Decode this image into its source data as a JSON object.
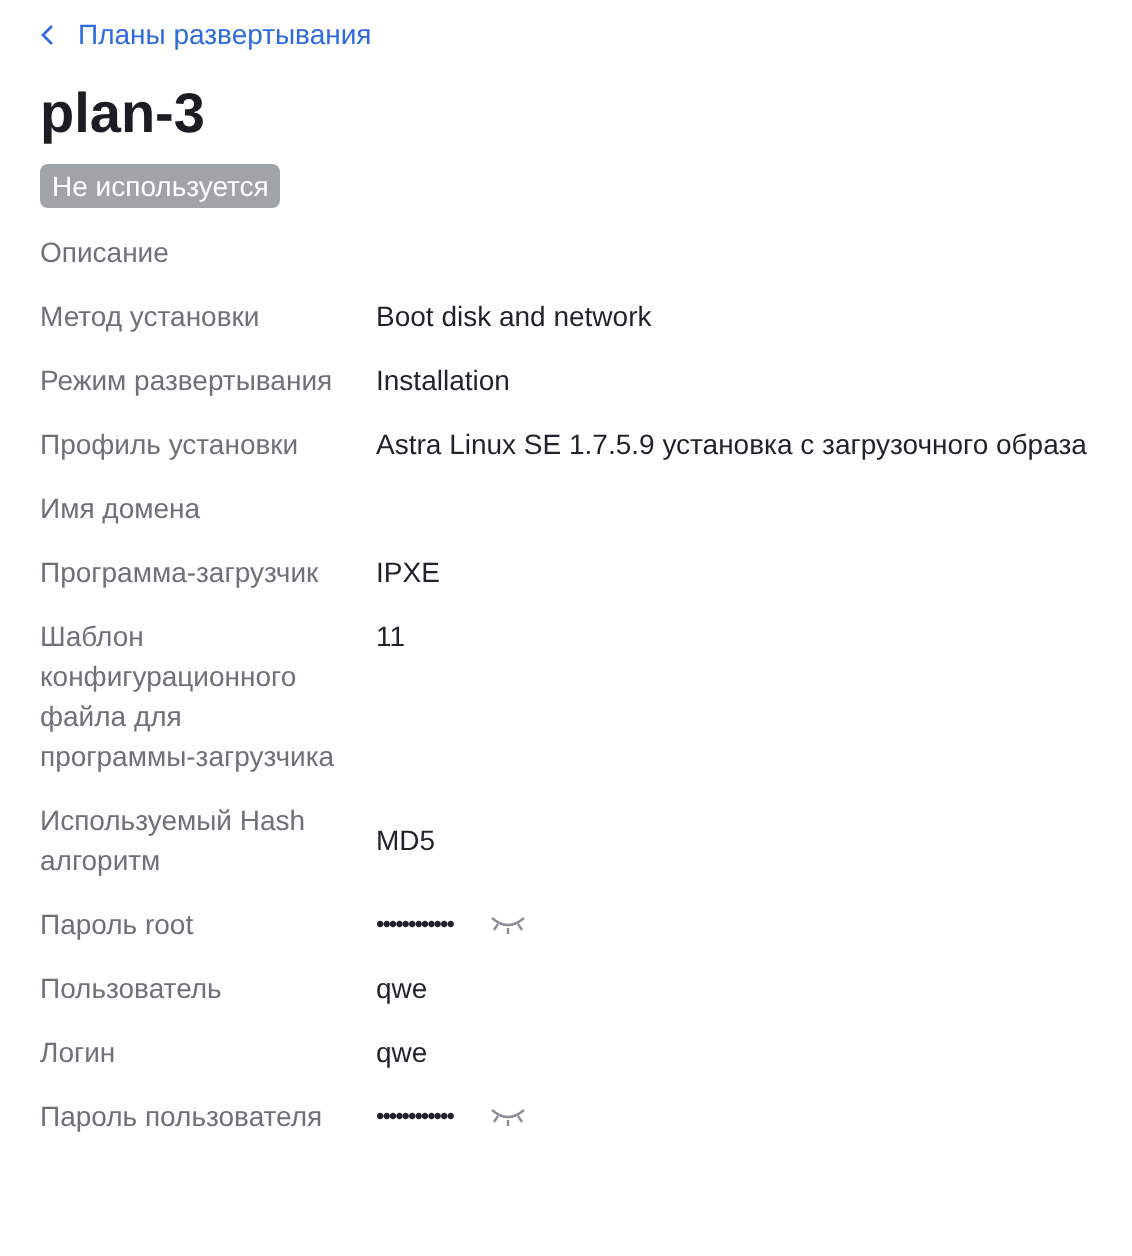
{
  "breadcrumb": {
    "label": "Планы развертывания"
  },
  "title": "plan-3",
  "status": {
    "label": "Не используется",
    "kind": "inactive"
  },
  "fields": [
    {
      "kind": "text",
      "label": "Описание"
    },
    {
      "kind": "text",
      "label": "Метод установки",
      "value": "Boot disk and network"
    },
    {
      "kind": "text",
      "label": "Режим развертывания",
      "value": "Installation"
    },
    {
      "kind": "text",
      "label": "Профиль установки",
      "value": "Astra Linux SE 1.7.5.9 установка с загрузочного образа"
    },
    {
      "kind": "text",
      "label": "Имя домена"
    },
    {
      "kind": "text",
      "label": "Программа-загрузчик",
      "value": "IPXE"
    },
    {
      "kind": "text",
      "label": "Шаблон конфигурационного файла для программы-загрузчика",
      "value": "11"
    },
    {
      "kind": "centered",
      "label": "Используемый Hash алгоритм",
      "value": "MD5"
    },
    {
      "kind": "password",
      "label": "Пароль root",
      "value": "••••••••••••"
    },
    {
      "kind": "text",
      "label": "Пользователь",
      "value": "qwe"
    },
    {
      "kind": "text",
      "label": "Логин",
      "value": "qwe"
    },
    {
      "kind": "password",
      "label": "Пароль пользователя",
      "value": "••••••••••••"
    }
  ]
}
